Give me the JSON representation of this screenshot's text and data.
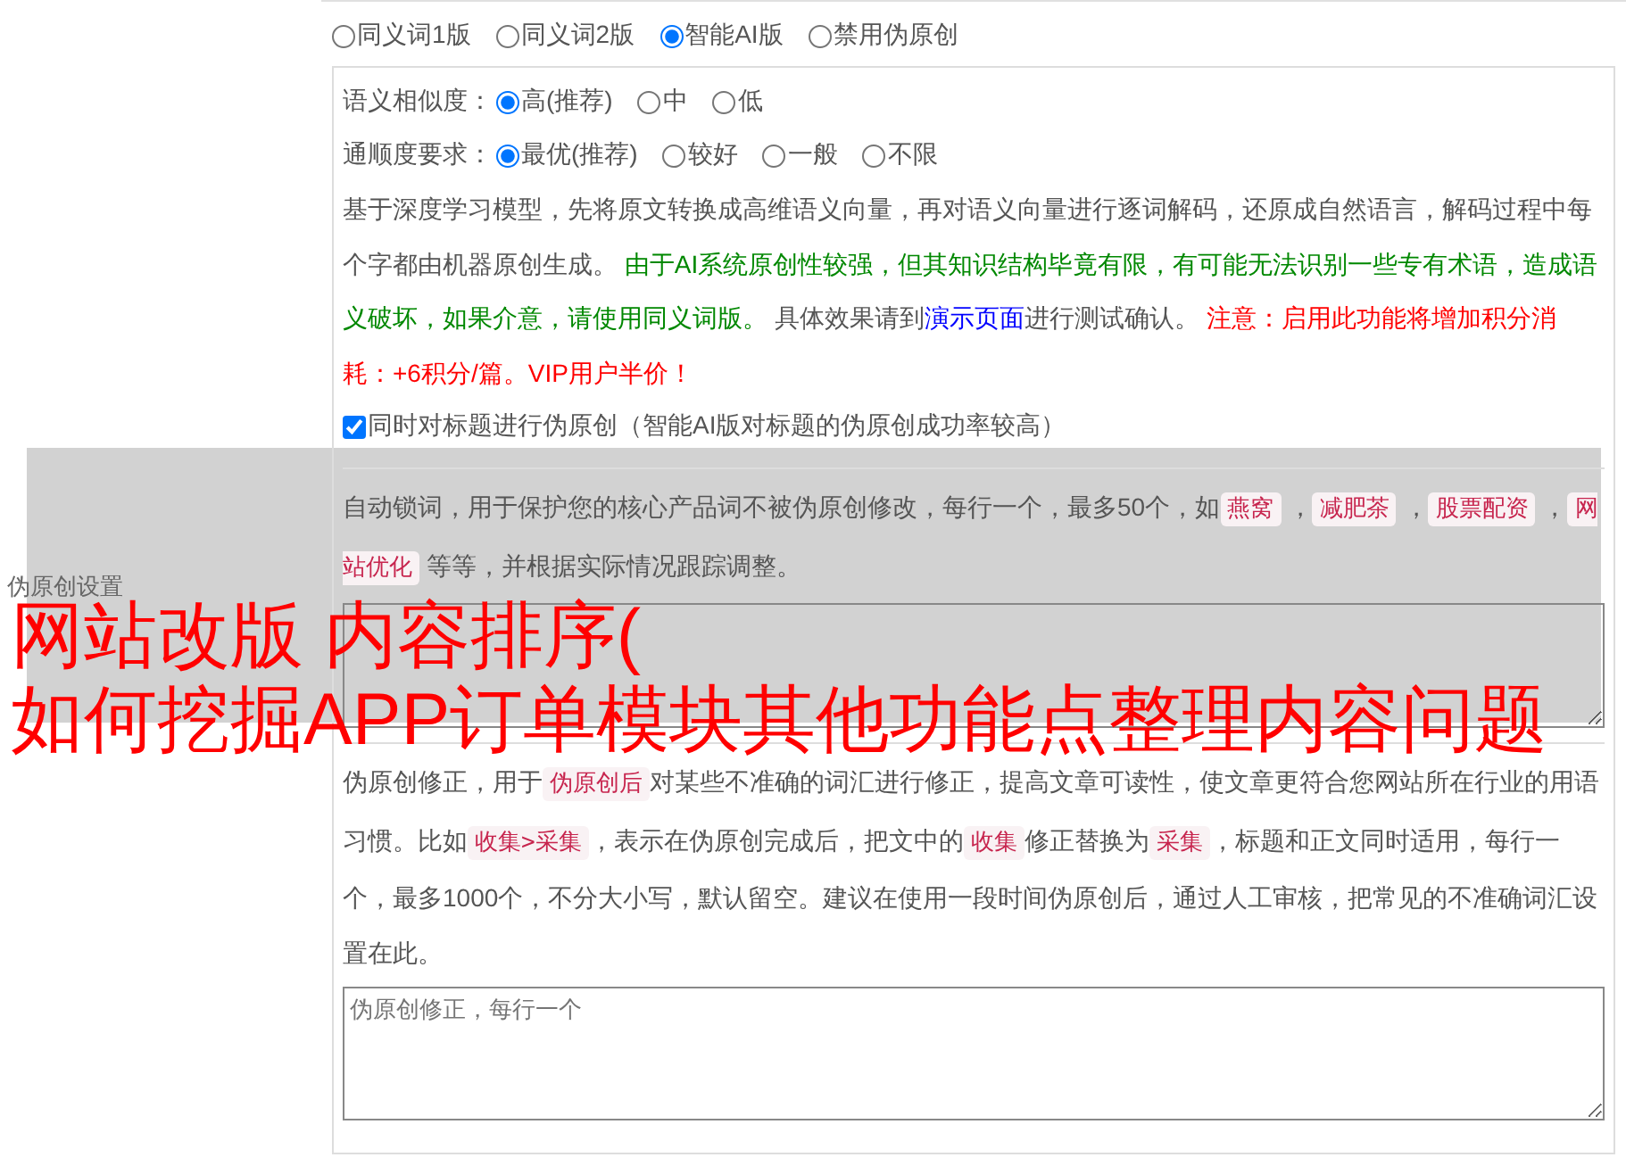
{
  "section_label": "伪原创设置",
  "modes": [
    {
      "label": "同义词1版",
      "selected": false
    },
    {
      "label": "同义词2版",
      "selected": false
    },
    {
      "label": "智能AI版",
      "selected": true
    },
    {
      "label": "禁用伪原创",
      "selected": false
    }
  ],
  "option_groups": [
    {
      "label": "语义相似度：",
      "options": [
        {
          "label": "高(推荐)",
          "selected": true
        },
        {
          "label": "中",
          "selected": false
        },
        {
          "label": "低",
          "selected": false
        }
      ]
    },
    {
      "label": "通顺度要求：",
      "options": [
        {
          "label": "最优(推荐)",
          "selected": true
        },
        {
          "label": "较好",
          "selected": false
        },
        {
          "label": "一般",
          "selected": false
        },
        {
          "label": "不限",
          "selected": false
        }
      ]
    }
  ],
  "ai_description": [
    {
      "kind": "plain",
      "text": "基于深度学习模型，先将原文转换成高维语义向量，再对语义向量进行逐词解码，还原成自然语言，解码过程中每个字都由机器原创生成。 "
    },
    {
      "kind": "green",
      "text": "由于AI系统原创性较强，但其知识结构毕竟有限，有可能无法识别一些专有术语，造成语义破坏，如果介意，请使用同义词版。"
    },
    {
      "kind": "plain",
      "text": " 具体效果请到"
    },
    {
      "kind": "link",
      "text": "演示页面"
    },
    {
      "kind": "plain",
      "text": "进行测试确认。 "
    },
    {
      "kind": "red",
      "text": "注意：启用此功能将增加积分消耗：+6积分/篇。VIP用户半价！"
    }
  ],
  "title_option": {
    "label": "同时对标题进行伪原创（智能AI版对标题的伪原创成功率较高）",
    "checked": true
  },
  "lock_words": {
    "description": [
      {
        "kind": "plain",
        "text": "自动锁词，用于保护您的核心产品词不被伪原创修改，每行一个，最多50个，如"
      },
      {
        "kind": "tag",
        "text": "燕窝"
      },
      {
        "kind": "plain",
        "text": " ，"
      },
      {
        "kind": "tag",
        "text": "减肥茶"
      },
      {
        "kind": "plain",
        "text": " ，"
      },
      {
        "kind": "tag",
        "text": "股票配资"
      },
      {
        "kind": "plain",
        "text": " ，"
      },
      {
        "kind": "tag",
        "text": "网站优化"
      },
      {
        "kind": "plain",
        "text": " 等等，并根据实际情况跟踪调整。"
      }
    ]
  },
  "corrections": {
    "description": [
      {
        "kind": "plain",
        "text": "伪原创修正，用于"
      },
      {
        "kind": "tag",
        "text": "伪原创后"
      },
      {
        "kind": "plain",
        "text": "对某些不准确的词汇进行修正，提高文章可读性，使文章更符合您网站所在行业的用语习惯。比如"
      },
      {
        "kind": "tag",
        "text": "收集>采集"
      },
      {
        "kind": "plain",
        "text": "，表示在伪原创完成后，把文中的"
      },
      {
        "kind": "tag",
        "text": "收集"
      },
      {
        "kind": "plain",
        "text": "修正替换为"
      },
      {
        "kind": "tag",
        "text": "采集"
      },
      {
        "kind": "plain",
        "text": "，标题和正文同时适用，每行一个，最多1000个，不分大小写，默认留空。建议在使用一段时间伪原创后，通过人工审核，把常见的不准确词汇设置在此。"
      }
    ],
    "placeholder": "伪原创修正，每行一个"
  },
  "overlay_title": [
    "网站改版 内容排序(",
    "如何挖掘APP订单模块其他功能点整理内容问题"
  ]
}
